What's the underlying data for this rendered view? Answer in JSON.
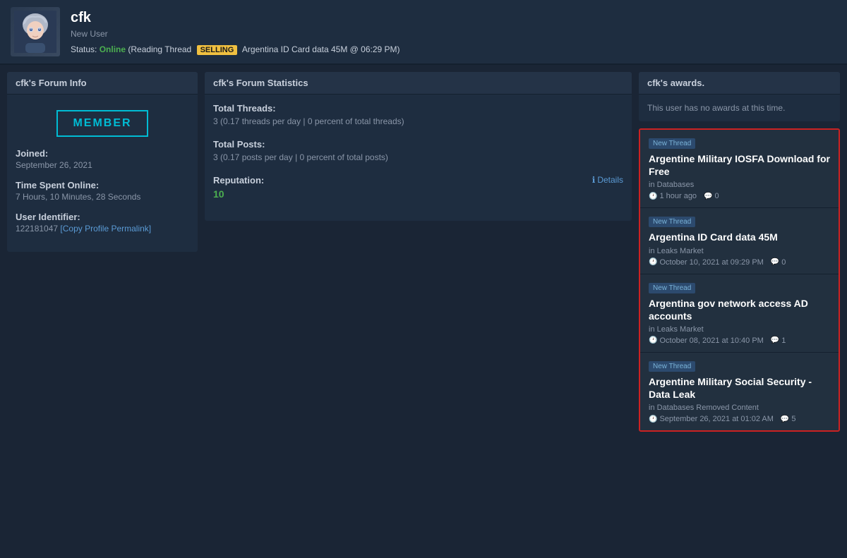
{
  "header": {
    "username": "cfk",
    "role": "New User",
    "status_prefix": "Status:",
    "status_online": "Online",
    "status_activity": "(Reading Thread",
    "status_badge": "SELLING",
    "status_detail": "Argentina ID Card data 45M @ 06:29 PM)"
  },
  "forum_info": {
    "title": "cfk's Forum Info",
    "badge": "MEMBER",
    "joined_label": "Joined:",
    "joined_value": "September 26, 2021",
    "time_label": "Time Spent Online:",
    "time_value": "7 Hours, 10 Minutes, 28 Seconds",
    "uid_label": "User Identifier:",
    "uid_value": "122181047",
    "copy_link": "[Copy Profile Permalink]"
  },
  "forum_stats": {
    "title": "cfk's Forum Statistics",
    "threads_label": "Total Threads:",
    "threads_value": "3 (0.17 threads per day | 0 percent of total threads)",
    "posts_label": "Total Posts:",
    "posts_value": "3 (0.17 posts per day | 0 percent of total posts)",
    "reputation_label": "Reputation:",
    "reputation_value": "10",
    "details_label": "Details"
  },
  "awards": {
    "title": "cfk's awards.",
    "empty_text": "This user has no awards at this time."
  },
  "threads": [
    {
      "badge": "New Thread",
      "title": "Argentine Military IOSFA Download for Free",
      "category": "in Databases",
      "time": "1 hour ago",
      "comments": "0"
    },
    {
      "badge": "New Thread",
      "title": "Argentina ID Card data 45M",
      "category": "in Leaks Market",
      "time": "October 10, 2021 at 09:29 PM",
      "comments": "0"
    },
    {
      "badge": "New Thread",
      "title": "Argentina gov network access AD accounts",
      "category": "in Leaks Market",
      "time": "October 08, 2021 at 10:40 PM",
      "comments": "1"
    },
    {
      "badge": "New Thread",
      "title": "Argentine Military Social Security - Data Leak",
      "category": "in Databases Removed Content",
      "time": "September 26, 2021 at 01:02 AM",
      "comments": "5"
    }
  ]
}
